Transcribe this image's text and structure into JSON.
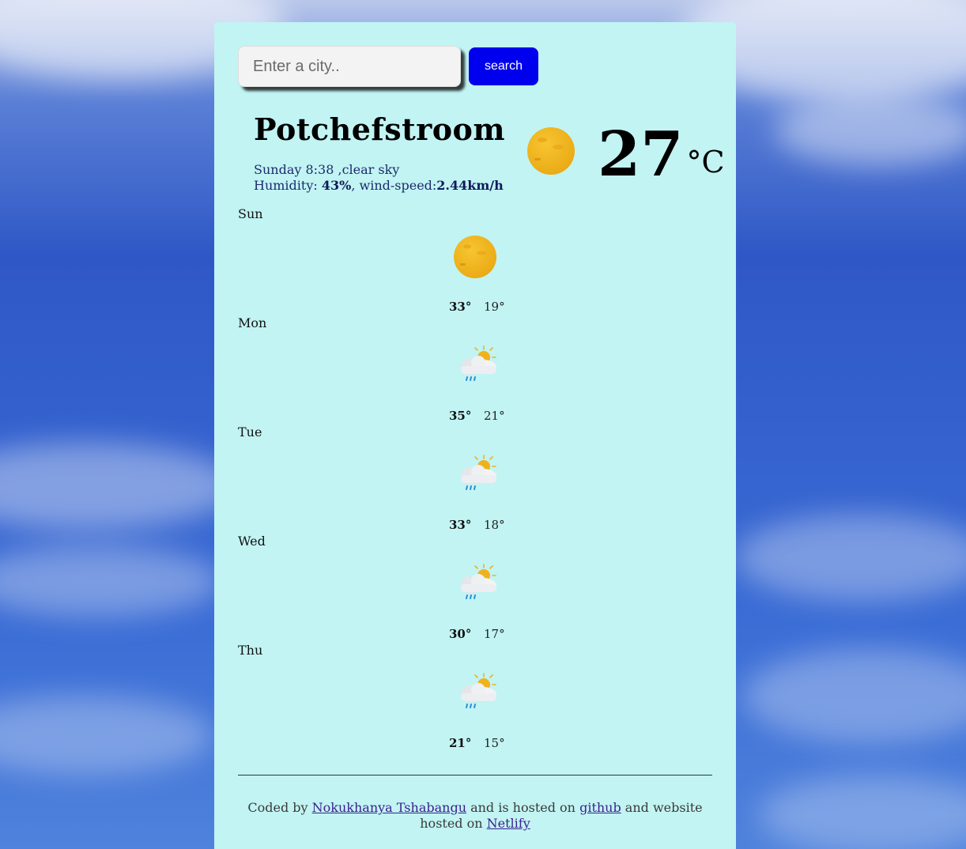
{
  "search": {
    "placeholder": "Enter a city..",
    "button_label": "search"
  },
  "current": {
    "city": "Potchefstroom",
    "day_time": "Sunday 8:38",
    "description": "clear sky",
    "humidity_label": "Humidity: ",
    "humidity": "43%",
    "wind_label": "wind-speed:",
    "wind_speed": "2.44km/h",
    "temperature": "27",
    "unit": "°C",
    "icon": "sun-icon"
  },
  "forecast": [
    {
      "day": "Sun",
      "icon": "sun-icon",
      "max": "33°",
      "min": "19°"
    },
    {
      "day": "Mon",
      "icon": "rain-cloud-sun-icon",
      "max": "35°",
      "min": "21°"
    },
    {
      "day": "Tue",
      "icon": "rain-cloud-sun-icon",
      "max": "33°",
      "min": "18°"
    },
    {
      "day": "Wed",
      "icon": "rain-cloud-sun-icon",
      "max": "30°",
      "min": "17°"
    },
    {
      "day": "Thu",
      "icon": "rain-cloud-sun-icon",
      "max": "21°",
      "min": "15°"
    }
  ],
  "footer": {
    "prefix": "Coded by ",
    "author": "Nokukhanya Tshabangu",
    "middle": " and is hosted on ",
    "github": "github",
    "middle2": " and website hosted on ",
    "netlify": "Netlify"
  },
  "colors": {
    "card_bg": "#c1f4f3",
    "button_bg": "#0000ee",
    "sun": "#f0b21c"
  }
}
